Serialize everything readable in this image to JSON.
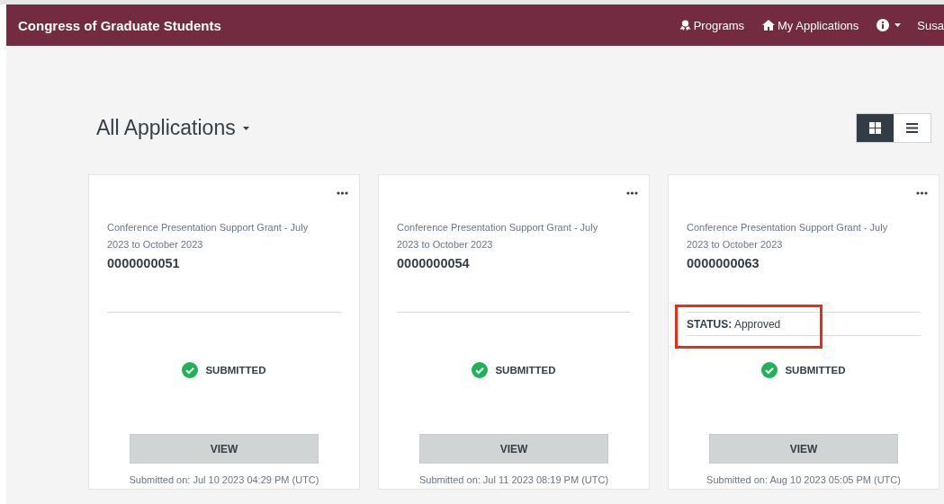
{
  "navbar": {
    "title": "Congress of Graduate Students",
    "links": [
      {
        "kind": "programs",
        "label": "Programs"
      },
      {
        "kind": "home",
        "label": "My Applications"
      }
    ],
    "user": "Susa"
  },
  "heading": "All Applications",
  "view_modes": [
    {
      "kind": "grid",
      "selected": true
    },
    {
      "kind": "list",
      "selected": false
    }
  ],
  "applications": [
    {
      "program": "Conference Presentation Support Grant - July 2023 to October 2023",
      "number": "0000000051",
      "highlighted": false,
      "state": "SUBMITTED",
      "button": "VIEW",
      "submitted_on": "Submitted on: Jul 10 2023 04:29 PM (UTC)"
    },
    {
      "program": "Conference Presentation Support Grant - July 2023 to October 2023",
      "number": "0000000054",
      "highlighted": false,
      "state": "SUBMITTED",
      "button": "VIEW",
      "submitted_on": "Submitted on: Jul 11 2023 08:19 PM (UTC)"
    },
    {
      "program": "Conference Presentation Support Grant - July 2023 to October 2023",
      "number": "0000000063",
      "status": "**STATUS:** Approved",
      "highlighted": true,
      "state": "SUBMITTED",
      "button": "VIEW",
      "submitted_on": "Submitted on: Aug 10 2023 05:05 PM (UTC)"
    }
  ]
}
